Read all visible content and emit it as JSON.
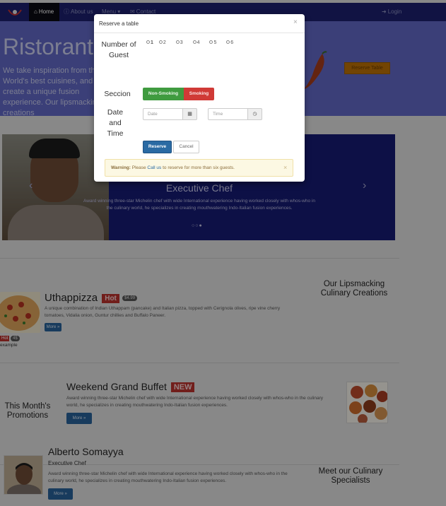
{
  "nav": {
    "items": [
      {
        "label": "Home",
        "icon": "home-icon",
        "glyph": "⌂"
      },
      {
        "label": "About us",
        "icon": "info-icon",
        "glyph": "ⓘ"
      },
      {
        "label": "Menu",
        "icon": "caret-down-icon",
        "glyph": "▾"
      },
      {
        "label": "Contact",
        "icon": "envelope-icon",
        "glyph": "✉"
      }
    ],
    "login_label": "Login",
    "login_glyph": "➜"
  },
  "jumbotron": {
    "title": "Ristorante",
    "text": "We take inspiration from the World's best cuisines, and create a unique fusion experience. Our lipsmacking creations",
    "button_label": "Reserve Table"
  },
  "carousel": {
    "title": "Executive Chef",
    "text": "Award winning three-star Michelin chef with wide International experience having worked closely with whos-who in the culinary world, he specializes in creating mouthwatering Indo-Italian fusion experiences.",
    "prev_glyph": "‹",
    "next_glyph": "›",
    "dots": "○○●"
  },
  "dishes": {
    "section_title": "Our Lipsmacking Culinary Creations",
    "name": "Uthappizza",
    "badge": "Hot",
    "price": "$4.99",
    "thumb_badge": "Hot",
    "thumb_price": "4$",
    "thumb_caption": "example",
    "description": "A unique combination of Indian Uthappam (pancake) and Italian pizza, topped with Cerignola olives, ripe vine cherry tomatoes, Vidalia onion, Guntur chillies and Buffalo Paneer.",
    "more_label": "More »"
  },
  "promotions": {
    "section_title": "This Month's Promotions",
    "name": "Weekend Grand Buffet",
    "badge": "NEW",
    "description": "Award winning three-star Michelin chef with wide International experience having worked closely with whos-who in the culinary world, he specializes in creating mouthwatering Indo-Italian fusion experiences.",
    "more_label": "More »"
  },
  "leaders": {
    "section_title": "Meet our Culinary Specialists",
    "name": "Alberto Somayya",
    "role": "Executive Chef",
    "description": "Award winning three-star Michelin chef with wide International experience having worked closely with whos-who in the culinary world, he specializes in creating mouthwatering Indo-Italian fusion experiences.",
    "more_label": "More »"
  },
  "modal": {
    "title": "Reserve a table",
    "close_glyph": "×",
    "guests_label": "Number of Guest",
    "guest_options": [
      "1",
      "2",
      "3",
      "4",
      "5",
      "6"
    ],
    "section_label": "Seccion",
    "non_smoking_label": "Non-Smoking",
    "smoking_label": "Smoking",
    "datetime_label": "Date and Time",
    "date_placeholder": "Date",
    "time_placeholder": "Time",
    "calendar_glyph": "▦",
    "clock_glyph": "◷",
    "reserve_label": "Reserve",
    "cancel_label": "Cancel",
    "alert_strong": "Warning:",
    "alert_prefix": "Please",
    "alert_link": "Call us",
    "alert_suffix": "to reserve for more than six guests.",
    "alert_close_glyph": "×"
  },
  "colors": {
    "navbar": "#1c1f6c",
    "jumbotron": "#5f66c2",
    "primary": "#2a6aa3",
    "success": "#3f9b3f",
    "danger": "#d03a36",
    "warning_bg": "#fcf8e3"
  }
}
